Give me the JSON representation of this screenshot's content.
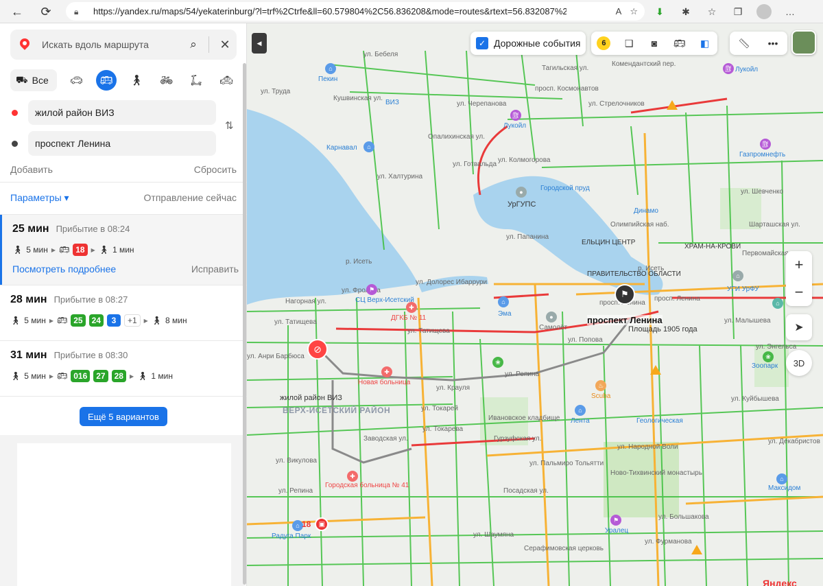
{
  "browser": {
    "url": "https://yandex.ru/maps/54/yekaterinburg/?l=trf%2Ctrfe&ll=60.579804%2C56.836208&mode=routes&rtext=56.832087%2..."
  },
  "panel": {
    "search_placeholder": "Искать вдоль маршрута",
    "mode_all": "Все",
    "from": "жилой район ВИЗ",
    "to": "проспект Ленина",
    "add": "Добавить",
    "reset": "Сбросить",
    "params": "Параметры ▾",
    "departure": "Отправление сейчас",
    "routes": [
      {
        "duration": "25 мин",
        "arrival": "Прибытие в 08:24",
        "walk1": "5 мин",
        "lines": [
          "18"
        ],
        "walk2": "1 мин",
        "details": "Посмотреть подробнее",
        "fix": "Исправить"
      },
      {
        "duration": "28 мин",
        "arrival": "Прибытие в 08:27",
        "walk1": "5 мин",
        "lines": [
          "25",
          "24",
          "3",
          "+1"
        ],
        "walk2": "8 мин"
      },
      {
        "duration": "31 мин",
        "arrival": "Прибытие в 08:30",
        "walk1": "5 мин",
        "lines": [
          "016",
          "27",
          "28"
        ],
        "walk2": "1 мин"
      }
    ],
    "more_variants": "Ещё 5 вариантов"
  },
  "map": {
    "traffic_events": "Дорожные события",
    "traffic_score": "6",
    "zoom_in": "+",
    "zoom_out": "−",
    "btn_3d": "3D",
    "stop_number": "18",
    "logo": "Яндекс",
    "labels": {
      "start": "жилой район ВИЗ",
      "end": "проспект Ленина",
      "district": "ВЕРХ-ИСЕТСКИЙ РАЙОН",
      "pond": "Городской пруд",
      "ploshchad": "Площадь 1905 года",
      "pravitelstvo": "ПРАВИТЕЛЬСТВО ОБЛАСТИ",
      "eltsin": "ЕЛЬЦИН ЦЕНТР",
      "hram": "ХРАМ-НА-КРОВИ",
      "urgups": "УрГУПС",
      "dinamo": "Динамо",
      "geologicheskaya": "Геологическая",
      "viz": "ВИЗ",
      "pekin": "Пекин",
      "lukoil1": "Лукойл",
      "lukoil2": "Лукойл",
      "karnaval": "Карнавал",
      "gazpromneft": "Газпромнефть",
      "sts": "СЦ Верх-Исетский",
      "dgkb": "ДГКБ № 11",
      "nova_bolnica": "Новая больница",
      "ema": "Эма",
      "samolet": "Самолёт",
      "scuba": "Scuba",
      "lenta": "Лента",
      "ivanovskoe": "Ивановское кладбище",
      "novo_tikhvin": "Ново-Тихвинский монастырь",
      "gor_bolnica": "Городская больница № 41",
      "raduga": "Радуга Парк",
      "uralec": "Уралец",
      "serafim": "Серафимовская церковь",
      "maksidom": "Максидом",
      "zoopark": "Зоопарк",
      "ugi": "УГИ УрФУ",
      "iset": "р. Исеть",
      "iset2": "р. Исеть",
      "st_tatishcheva": "ул. Татищева",
      "st_tatishcheva2": "ул. Татищева",
      "st_lenina": "просп. Ленина",
      "st_lenina2": "просп. Ленина",
      "st_malysheva": "ул. Малышева",
      "st_kuibysheva": "ул. Куйбышева",
      "st_gurzufskaya": "Гурзуфская ул.",
      "st_kraulya": "ул. Крауля",
      "st_repina": "ул. Репина",
      "st_repina2": "ул. Репина",
      "st_popova": "ул. Попова",
      "st_frolova": "ул. Фролова",
      "st_nagornaya": "Нагорная ул.",
      "st_barbyusa": "ул. Анри Барбюса",
      "st_ibarruri": "ул. Долорес Ибаррури",
      "st_papanina": "ул. Папанина",
      "st_kolmogorova": "ул. Колмогорова",
      "st_kosmonavtov": "просп. Космонавтов",
      "st_gotvalda": "ул. Готвальда",
      "st_bebelya": "ул. Бебеля",
      "st_hal": "ул. Халтурина",
      "st_tokarey": "ул. Токарей",
      "st_cherepanova": "ул. Черепанова",
      "st_strelochnikov": "ул. Стрелочников",
      "st_komendantskaya": "Комендантский пер.",
      "st_tagilskaya": "Тагильская ул.",
      "st_shevchenko": "ул. Шевченко",
      "st_shartashskaya": "Шарташская ул.",
      "st_pervomayskaya": "Первомайская ул.",
      "st_engelsa": "ул. Энгельса",
      "st_dekabristov": "ул. Декабристов",
      "st_narodnoy_voli": "ул. Народной Воли",
      "st_bolshakova": "ул. Большакова",
      "st_furmanova": "ул. Фурманова",
      "st_shaumyana": "ул. Шаумяна",
      "st_posadskaya": "Посадская ул.",
      "st_tolyatti": "ул. Пальмиро Тольятти",
      "st_vikulova": "ул. Викулова",
      "st_zavodskaya": "Заводская ул.",
      "st_olimpiyskaya": "Олимпийская наб.",
      "st_kushvinskaya": "Кушвинская ул.",
      "st_truda": "ул. Труда",
      "st_tokareva": "ул. Токарева",
      "st_opalikhinskaya": "Опалихинская ул."
    }
  }
}
